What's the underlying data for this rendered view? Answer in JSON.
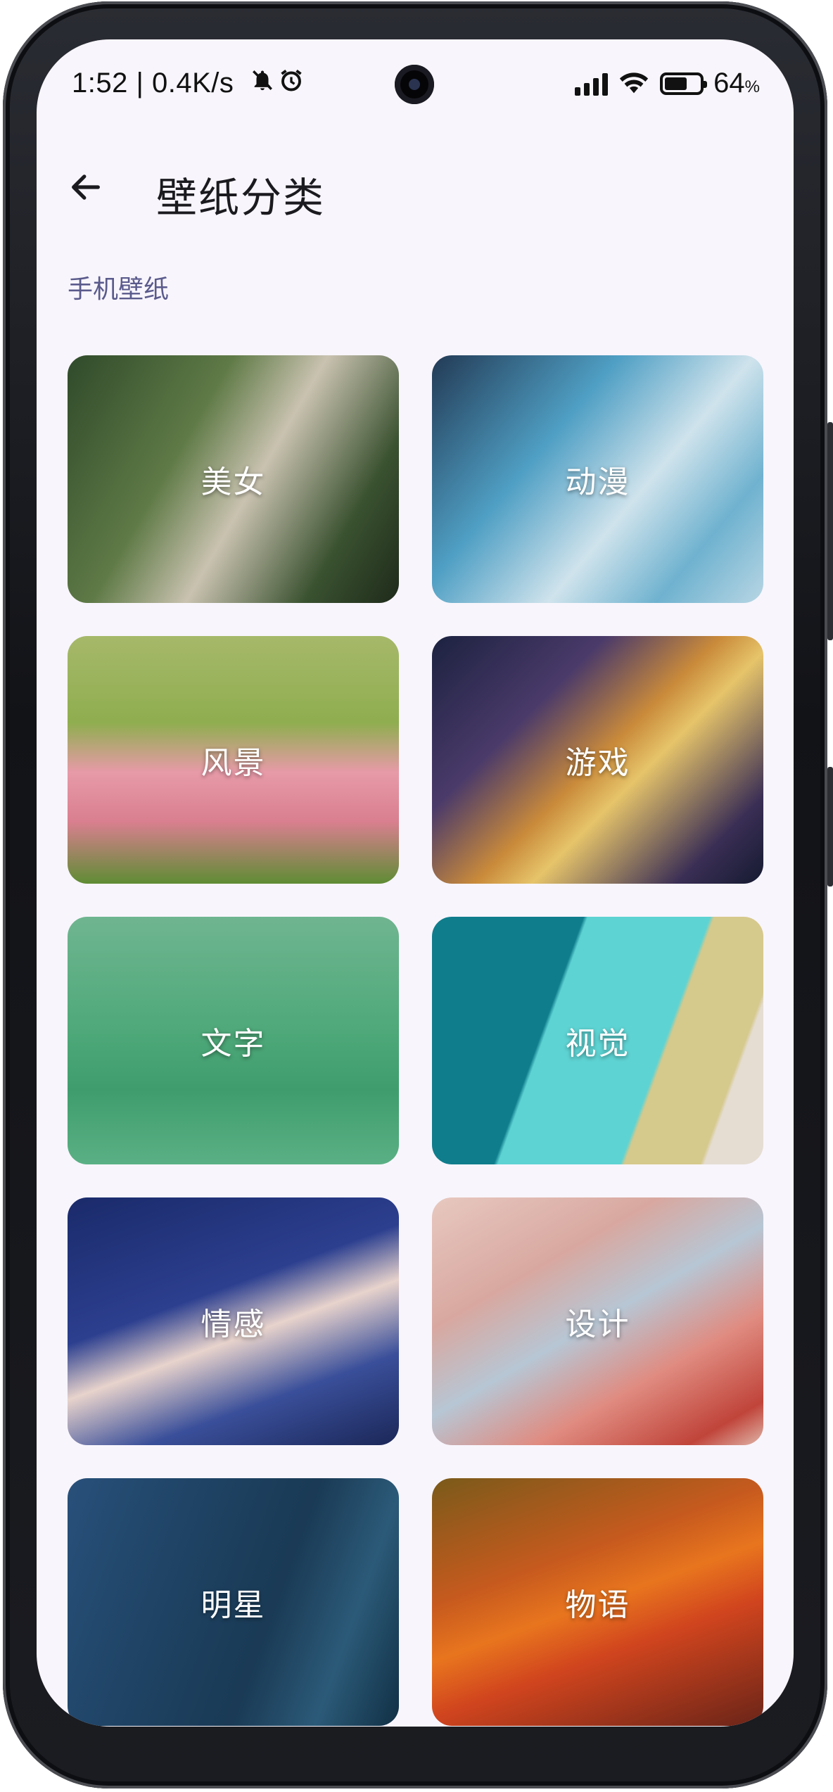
{
  "status_bar": {
    "time": "1:52 | 0.4K/s",
    "mute_icon": "bell-off-icon",
    "alarm_icon": "alarm-icon",
    "battery_percent": "64",
    "battery_unit": "%",
    "battery_level": 0.64
  },
  "app_bar": {
    "back_icon": "arrow-left-icon",
    "title": "壁纸分类"
  },
  "section": {
    "title": "手机壁纸"
  },
  "categories": [
    {
      "label": "美女",
      "bg": "linear-gradient(120deg,#2f4a2a 0%,#5f7a46 35%,#c9c2b0 55%,#3a5230 80%,#1e2a1a 100%)"
    },
    {
      "label": "动漫",
      "bg": "linear-gradient(130deg,#223a55 0%,#4f9fc4 35%,#cfe3ec 60%,#6fb2cf 80%,#b8d6e4 100%)"
    },
    {
      "label": "风景",
      "bg": "linear-gradient(180deg,#a6b86a 0%,#8fae4f 35%,#e79aa8 55%,#d97f8f 75%,#5f8c34 100%)"
    },
    {
      "label": "游戏",
      "bg": "linear-gradient(135deg,#1c2240 0%,#4a3a6a 30%,#c98a3a 50%,#e6c46a 60%,#3a2e55 85%,#151a30 100%)"
    },
    {
      "label": "文字",
      "bg": "linear-gradient(180deg,#6fb590 0%,#4fa97a 45%,#3f9d6d 70%,#5ab084 100%)"
    },
    {
      "label": "视觉",
      "bg": "linear-gradient(110deg,#0f7d8c 0%,#0f7d8c 36%,#5ed3d3 37%,#5ed3d3 66%,#d6c98c 67%,#d6c98c 85%,#e5ddd2 86%,#e5ddd2 100%)"
    },
    {
      "label": "情感",
      "bg": "linear-gradient(160deg,#1a2a6a 0%,#2c3f8f 40%,#e8d3cc 55%,#3a4f9a 75%,#1b2758 100%)"
    },
    {
      "label": "设计",
      "bg": "linear-gradient(150deg,#e7c8c0 0%,#d8a8a0 30%,#b7c6d4 50%,#e08b80 70%,#c0443a 90%,#e0b5a8 100%)"
    },
    {
      "label": "明星",
      "bg": "linear-gradient(110deg,#28507a 0%,#1f4466 30%,#1a3a55 60%,#2b5a78 80%,#113045 100%)"
    },
    {
      "label": "物语",
      "bg": "linear-gradient(160deg,#7a5a1a 0%,#c75a1e 35%,#e8751e 50%,#d1451e 65%,#6a2418 100%)"
    }
  ]
}
